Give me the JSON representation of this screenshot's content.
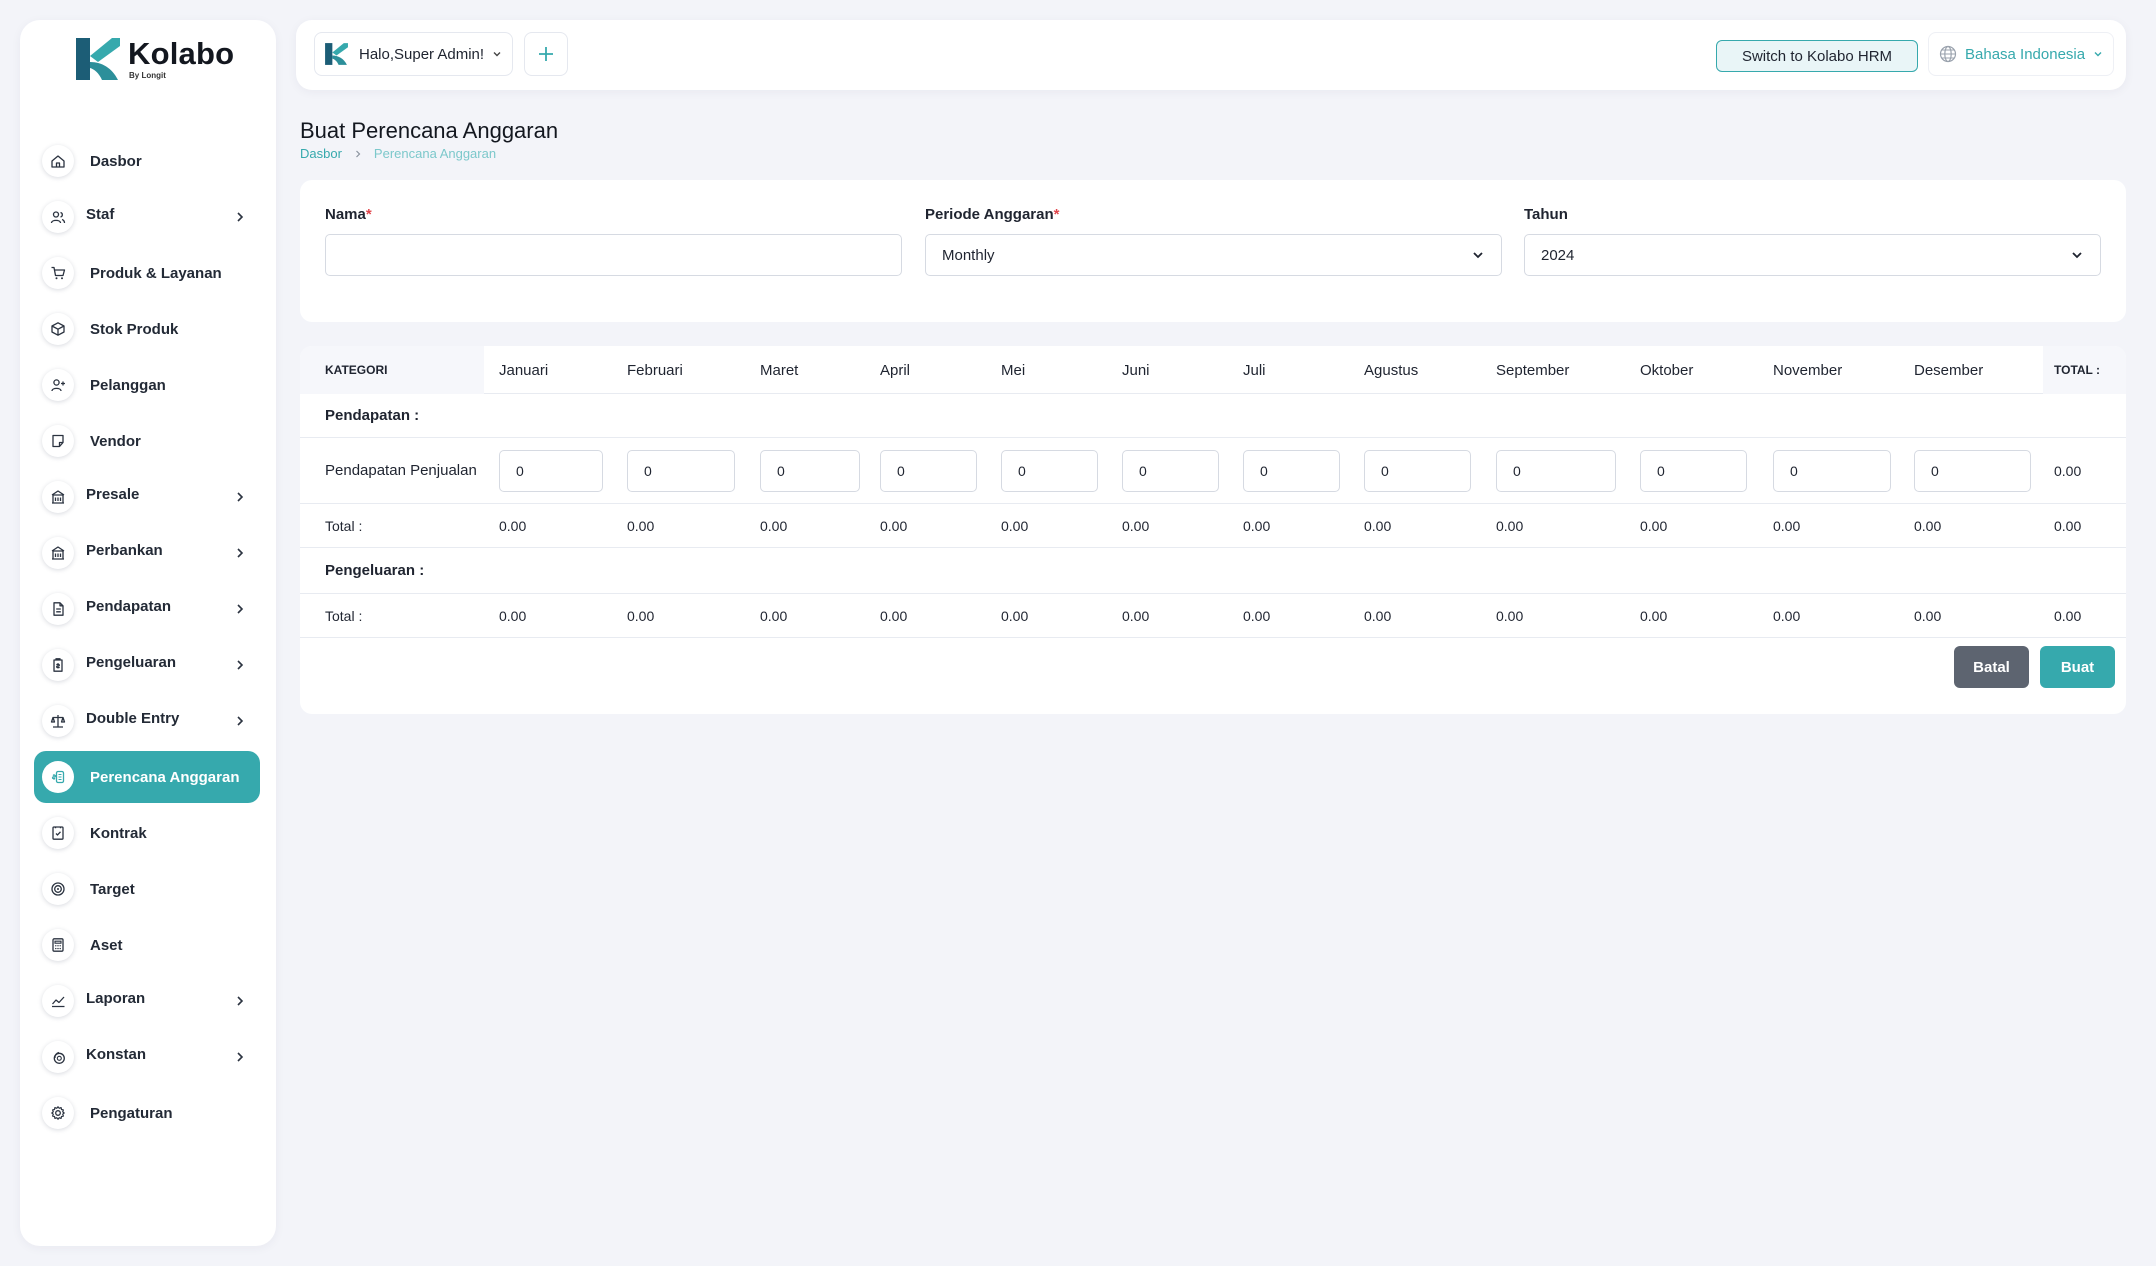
{
  "brand": {
    "name": "Kolabo",
    "sub": "By Longit",
    "teal": "#36a9ad"
  },
  "sidebar": {
    "items": [
      {
        "label": "Dasbor",
        "icon": "home-icon",
        "chevron": false,
        "active": false
      },
      {
        "label": "Staf",
        "icon": "users-icon",
        "chevron": true,
        "active": false
      },
      {
        "label": "Produk & Layanan",
        "icon": "cart-icon",
        "chevron": false,
        "active": false
      },
      {
        "label": "Stok Produk",
        "icon": "box-icon",
        "chevron": false,
        "active": false
      },
      {
        "label": "Pelanggan",
        "icon": "user-plus-icon",
        "chevron": false,
        "active": false
      },
      {
        "label": "Vendor",
        "icon": "note-icon",
        "chevron": false,
        "active": false
      },
      {
        "label": "Presale",
        "icon": "building-icon",
        "chevron": true,
        "active": false
      },
      {
        "label": "Perbankan",
        "icon": "bank-icon",
        "chevron": true,
        "active": false
      },
      {
        "label": "Pendapatan",
        "icon": "file-icon",
        "chevron": true,
        "active": false
      },
      {
        "label": "Pengeluaran",
        "icon": "clipboard-icon",
        "chevron": true,
        "active": false
      },
      {
        "label": "Double Entry",
        "icon": "scale-icon",
        "chevron": true,
        "active": false
      },
      {
        "label": "Perencana Anggaran",
        "icon": "budget-icon",
        "chevron": false,
        "active": true
      },
      {
        "label": "Kontrak",
        "icon": "contract-icon",
        "chevron": false,
        "active": false
      },
      {
        "label": "Target",
        "icon": "target-icon",
        "chevron": false,
        "active": false
      },
      {
        "label": "Aset",
        "icon": "calculator-icon",
        "chevron": false,
        "active": false
      },
      {
        "label": "Laporan",
        "icon": "chart-line-icon",
        "chevron": true,
        "active": false
      },
      {
        "label": "Konstan",
        "icon": "coins-icon",
        "chevron": true,
        "active": false
      },
      {
        "label": "Pengaturan",
        "icon": "gear-icon",
        "chevron": false,
        "active": false
      }
    ]
  },
  "topbar": {
    "greeting": "Halo,Super Admin!",
    "switch_label": "Switch to Kolabo HRM",
    "language": "Bahasa Indonesia"
  },
  "page": {
    "title": "Buat Perencana Anggaran",
    "breadcrumb": {
      "home": "Dasbor",
      "current": "Perencana Anggaran"
    }
  },
  "form": {
    "name_label": "Nama",
    "name_value": "",
    "period_label": "Periode Anggaran",
    "period_value": "Monthly",
    "year_label": "Tahun",
    "year_value": "2024",
    "required_mark": "*"
  },
  "table": {
    "category_header": "KATEGORI",
    "total_header": "TOTAL :",
    "months": [
      "Januari",
      "Februari",
      "Maret",
      "April",
      "Mei",
      "Juni",
      "Juli",
      "Agustus",
      "September",
      "Oktober",
      "November",
      "Desember"
    ],
    "income_section": "Pendapatan :",
    "income_row": {
      "label": "Pendapatan Penjualan",
      "values": [
        "0",
        "0",
        "0",
        "0",
        "0",
        "0",
        "0",
        "0",
        "0",
        "0",
        "0",
        "0"
      ],
      "total": "0.00"
    },
    "income_total": {
      "label": "Total :",
      "values": [
        "0.00",
        "0.00",
        "0.00",
        "0.00",
        "0.00",
        "0.00",
        "0.00",
        "0.00",
        "0.00",
        "0.00",
        "0.00",
        "0.00"
      ],
      "total": "0.00"
    },
    "expense_section": "Pengeluaran :",
    "expense_total": {
      "label": "Total :",
      "values": [
        "0.00",
        "0.00",
        "0.00",
        "0.00",
        "0.00",
        "0.00",
        "0.00",
        "0.00",
        "0.00",
        "0.00",
        "0.00",
        "0.00"
      ],
      "total": "0.00"
    }
  },
  "actions": {
    "cancel": "Batal",
    "create": "Buat"
  }
}
